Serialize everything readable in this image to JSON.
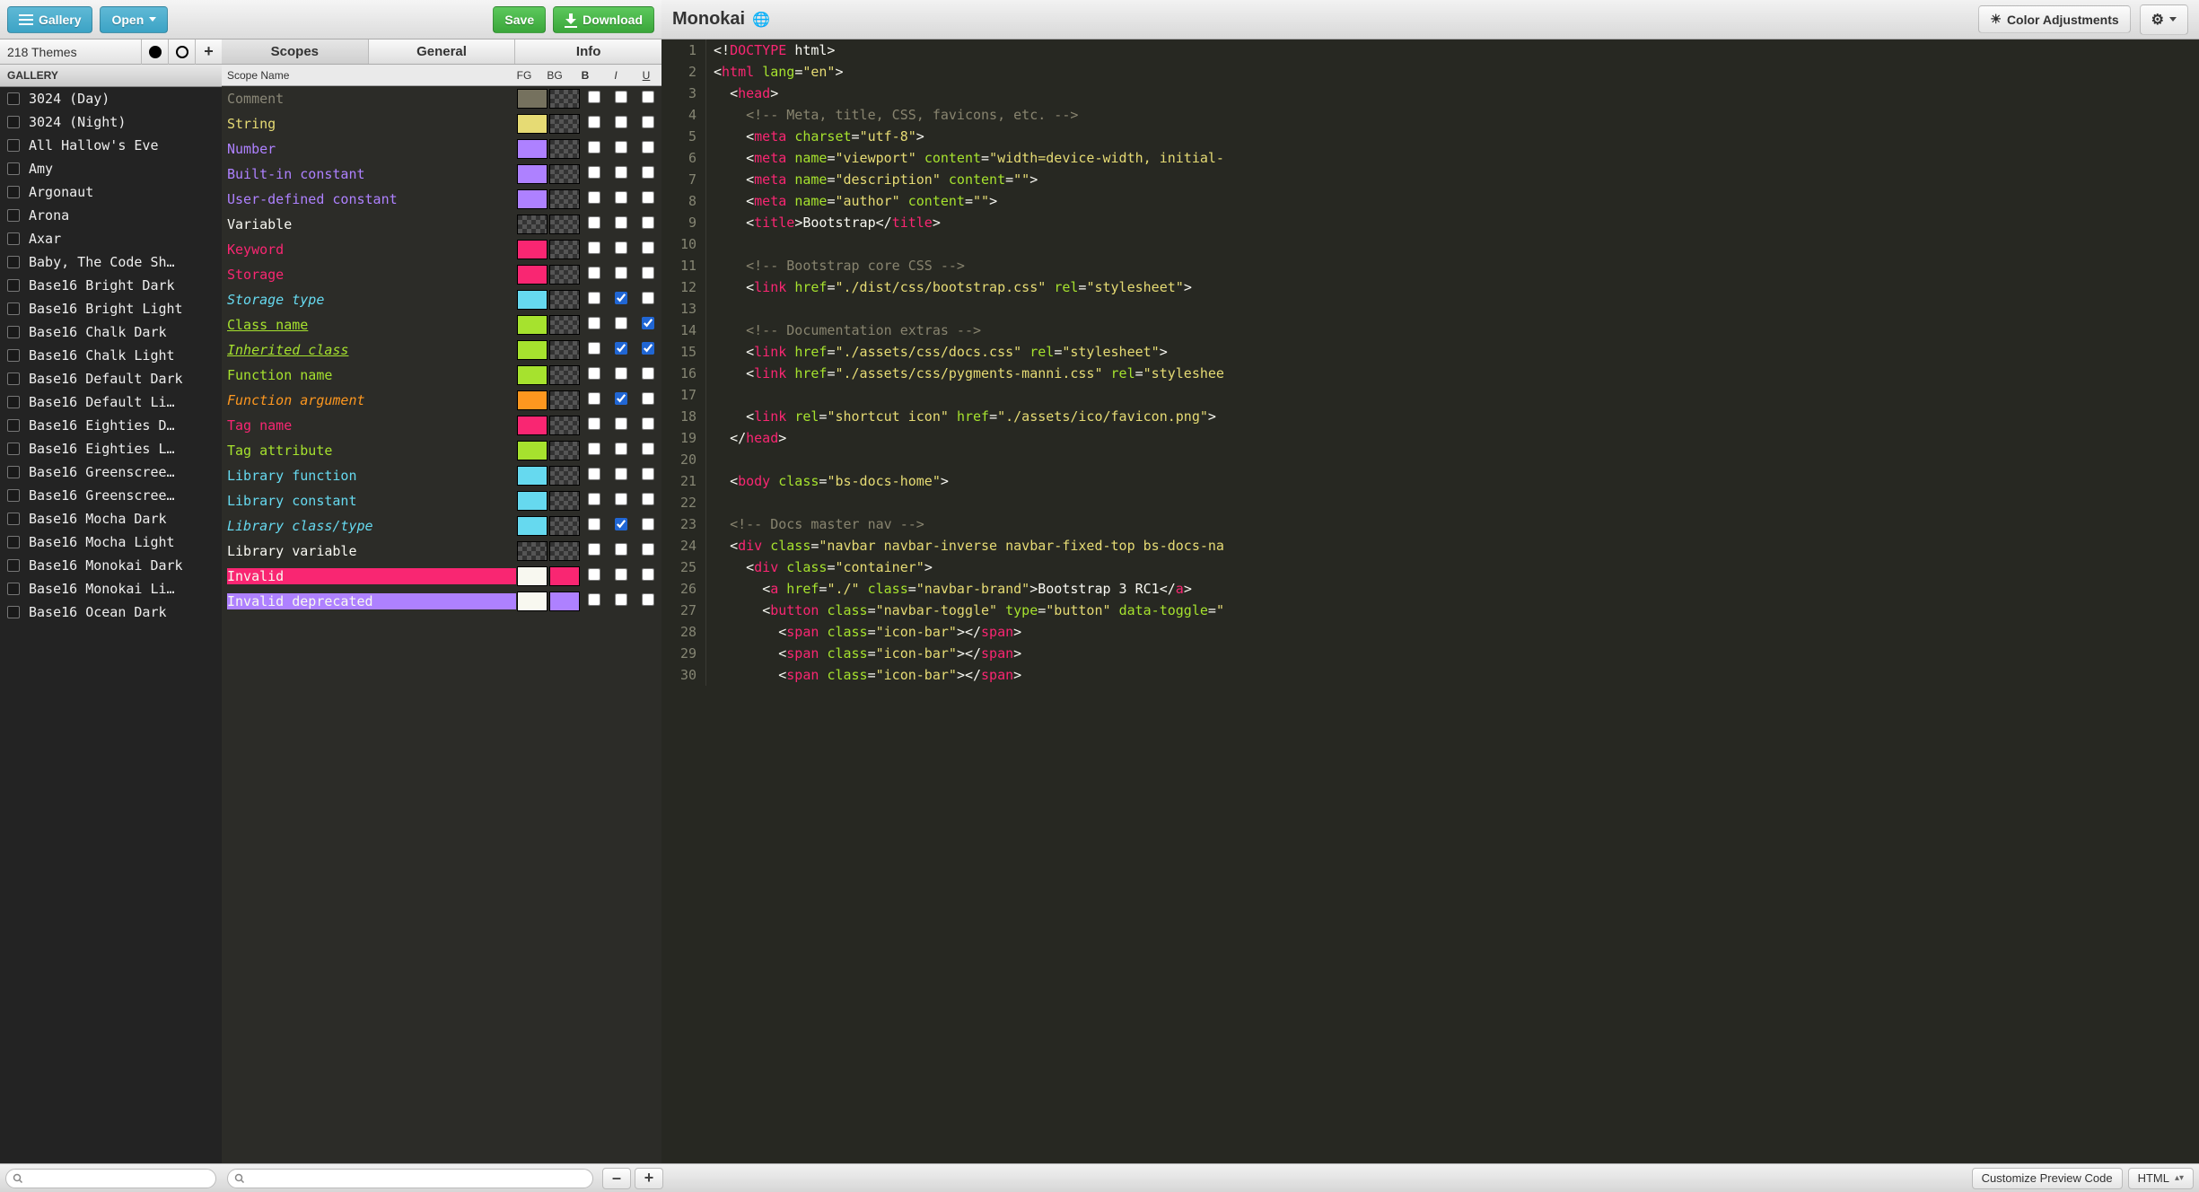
{
  "toolbar": {
    "gallery_label": "Gallery",
    "open_label": "Open",
    "save_label": "Save",
    "download_label": "Download",
    "color_adjust_label": "Color Adjustments"
  },
  "preview_title": "Monokai",
  "gallery": {
    "count_label": "218 Themes",
    "header_label": "GALLERY",
    "items": [
      "3024 (Day)",
      "3024 (Night)",
      "All Hallow's Eve",
      "Amy",
      "Argonaut",
      "Arona",
      "Axar",
      "Baby, The Code Sh…",
      "Base16 Bright Dark",
      "Base16 Bright Light",
      "Base16 Chalk Dark",
      "Base16 Chalk Light",
      "Base16 Default Dark",
      "Base16 Default Li…",
      "Base16 Eighties D…",
      "Base16 Eighties L…",
      "Base16 Greenscree…",
      "Base16 Greenscree…",
      "Base16 Mocha Dark",
      "Base16 Mocha Light",
      "Base16 Monokai Dark",
      "Base16 Monokai Li…",
      "Base16 Ocean Dark"
    ]
  },
  "tabs": {
    "scopes": "Scopes",
    "general": "General",
    "info": "Info",
    "active": "scopes"
  },
  "scope_header": {
    "name": "Scope Name",
    "fg": "FG",
    "bg": "BG",
    "b": "B",
    "i": "I",
    "u": "U"
  },
  "scopes": [
    {
      "name": "Comment",
      "fgColor": "#75715e",
      "bgColor": null,
      "b": false,
      "i": false,
      "u": false,
      "style": "color:#8a8777"
    },
    {
      "name": "String",
      "fgColor": "#e6db74",
      "bgColor": null,
      "b": false,
      "i": false,
      "u": false,
      "style": "color:#e6db74"
    },
    {
      "name": "Number",
      "fgColor": "#ae81ff",
      "bgColor": null,
      "b": false,
      "i": false,
      "u": false,
      "style": "color:#ae81ff"
    },
    {
      "name": "Built-in constant",
      "fgColor": "#ae81ff",
      "bgColor": null,
      "b": false,
      "i": false,
      "u": false,
      "style": "color:#ae81ff"
    },
    {
      "name": "User-defined constant",
      "fgColor": "#ae81ff",
      "bgColor": null,
      "b": false,
      "i": false,
      "u": false,
      "style": "color:#ae81ff"
    },
    {
      "name": "Variable",
      "fgColor": null,
      "bgColor": null,
      "b": false,
      "i": false,
      "u": false,
      "style": "color:#f8f8f2"
    },
    {
      "name": "Keyword",
      "fgColor": "#f92672",
      "bgColor": null,
      "b": false,
      "i": false,
      "u": false,
      "style": "color:#f92672"
    },
    {
      "name": "Storage",
      "fgColor": "#f92672",
      "bgColor": null,
      "b": false,
      "i": false,
      "u": false,
      "style": "color:#f92672"
    },
    {
      "name": "Storage type",
      "fgColor": "#66d9ef",
      "bgColor": null,
      "b": false,
      "i": true,
      "u": false,
      "style": "color:#66d9ef;font-style:italic"
    },
    {
      "name": "Class name",
      "fgColor": "#a6e22e",
      "bgColor": null,
      "b": false,
      "i": false,
      "u": true,
      "style": "color:#a6e22e;text-decoration:underline"
    },
    {
      "name": "Inherited class",
      "fgColor": "#a6e22e",
      "bgColor": null,
      "b": false,
      "i": true,
      "u": true,
      "style": "color:#a6e22e;font-style:italic;text-decoration:underline"
    },
    {
      "name": "Function name",
      "fgColor": "#a6e22e",
      "bgColor": null,
      "b": false,
      "i": false,
      "u": false,
      "style": "color:#a6e22e"
    },
    {
      "name": "Function argument",
      "fgColor": "#fd971f",
      "bgColor": null,
      "b": false,
      "i": true,
      "u": false,
      "style": "color:#fd971f;font-style:italic"
    },
    {
      "name": "Tag name",
      "fgColor": "#f92672",
      "bgColor": null,
      "b": false,
      "i": false,
      "u": false,
      "style": "color:#f92672"
    },
    {
      "name": "Tag attribute",
      "fgColor": "#a6e22e",
      "bgColor": null,
      "b": false,
      "i": false,
      "u": false,
      "style": "color:#a6e22e"
    },
    {
      "name": "Library function",
      "fgColor": "#66d9ef",
      "bgColor": null,
      "b": false,
      "i": false,
      "u": false,
      "style": "color:#66d9ef"
    },
    {
      "name": "Library constant",
      "fgColor": "#66d9ef",
      "bgColor": null,
      "b": false,
      "i": false,
      "u": false,
      "style": "color:#66d9ef"
    },
    {
      "name": "Library class/type",
      "fgColor": "#66d9ef",
      "bgColor": null,
      "b": false,
      "i": true,
      "u": false,
      "style": "color:#66d9ef;font-style:italic"
    },
    {
      "name": "Library variable",
      "fgColor": null,
      "bgColor": null,
      "b": false,
      "i": false,
      "u": false,
      "style": "color:#f8f8f2"
    },
    {
      "name": "Invalid",
      "fgColor": "#f8f8f0",
      "bgColor": "#f92672",
      "b": false,
      "i": false,
      "u": false,
      "style": "color:#f8f8f0;background:#f92672"
    },
    {
      "name": "Invalid deprecated",
      "fgColor": "#f8f8f0",
      "bgColor": "#ae81ff",
      "b": false,
      "i": false,
      "u": false,
      "style": "color:#f8f8f0;background:#ae81ff"
    }
  ],
  "editor_lines": [
    {
      "n": 1,
      "html": "<span class='t-punc'>&lt;!</span><span class='t-doc'>DOCTYPE</span> <span class='t-punc'>html&gt;</span>"
    },
    {
      "n": 2,
      "html": "<span class='t-punc'>&lt;</span><span class='t-tag'>html</span> <span class='t-attr'>lang</span><span class='t-punc'>=</span><span class='t-str'>\"en\"</span><span class='t-punc'>&gt;</span>"
    },
    {
      "n": 3,
      "html": "  <span class='t-punc'>&lt;</span><span class='t-tag'>head</span><span class='t-punc'>&gt;</span>"
    },
    {
      "n": 4,
      "html": "    <span class='t-com'>&lt;!-- Meta, title, CSS, favicons, etc. --&gt;</span>"
    },
    {
      "n": 5,
      "html": "    <span class='t-punc'>&lt;</span><span class='t-tag'>meta</span> <span class='t-attr'>charset</span><span class='t-punc'>=</span><span class='t-str'>\"utf-8\"</span><span class='t-punc'>&gt;</span>"
    },
    {
      "n": 6,
      "html": "    <span class='t-punc'>&lt;</span><span class='t-tag'>meta</span> <span class='t-attr'>name</span><span class='t-punc'>=</span><span class='t-str'>\"viewport\"</span> <span class='t-attr'>content</span><span class='t-punc'>=</span><span class='t-str'>\"width=device-width, initial-</span>"
    },
    {
      "n": 7,
      "html": "    <span class='t-punc'>&lt;</span><span class='t-tag'>meta</span> <span class='t-attr'>name</span><span class='t-punc'>=</span><span class='t-str'>\"description\"</span> <span class='t-attr'>content</span><span class='t-punc'>=</span><span class='t-str'>\"\"</span><span class='t-punc'>&gt;</span>"
    },
    {
      "n": 8,
      "html": "    <span class='t-punc'>&lt;</span><span class='t-tag'>meta</span> <span class='t-attr'>name</span><span class='t-punc'>=</span><span class='t-str'>\"author\"</span> <span class='t-attr'>content</span><span class='t-punc'>=</span><span class='t-str'>\"\"</span><span class='t-punc'>&gt;</span>"
    },
    {
      "n": 9,
      "html": "    <span class='t-punc'>&lt;</span><span class='t-tag'>title</span><span class='t-punc'>&gt;</span><span class='t-punc'>Bootstrap</span><span class='t-punc'>&lt;/</span><span class='t-tag'>title</span><span class='t-punc'>&gt;</span>"
    },
    {
      "n": 10,
      "html": ""
    },
    {
      "n": 11,
      "html": "    <span class='t-com'>&lt;!-- Bootstrap core CSS --&gt;</span>"
    },
    {
      "n": 12,
      "html": "    <span class='t-punc'>&lt;</span><span class='t-tag'>link</span> <span class='t-attr'>href</span><span class='t-punc'>=</span><span class='t-str'>\"./dist/css/bootstrap.css\"</span> <span class='t-attr'>rel</span><span class='t-punc'>=</span><span class='t-str'>\"stylesheet\"</span><span class='t-punc'>&gt;</span>"
    },
    {
      "n": 13,
      "html": ""
    },
    {
      "n": 14,
      "html": "    <span class='t-com'>&lt;!-- Documentation extras --&gt;</span>"
    },
    {
      "n": 15,
      "html": "    <span class='t-punc'>&lt;</span><span class='t-tag'>link</span> <span class='t-attr'>href</span><span class='t-punc'>=</span><span class='t-str'>\"./assets/css/docs.css\"</span> <span class='t-attr'>rel</span><span class='t-punc'>=</span><span class='t-str'>\"stylesheet\"</span><span class='t-punc'>&gt;</span>"
    },
    {
      "n": 16,
      "html": "    <span class='t-punc'>&lt;</span><span class='t-tag'>link</span> <span class='t-attr'>href</span><span class='t-punc'>=</span><span class='t-str'>\"./assets/css/pygments-manni.css\"</span> <span class='t-attr'>rel</span><span class='t-punc'>=</span><span class='t-str'>\"styleshee</span>"
    },
    {
      "n": 17,
      "html": ""
    },
    {
      "n": 18,
      "html": "    <span class='t-punc'>&lt;</span><span class='t-tag'>link</span> <span class='t-attr'>rel</span><span class='t-punc'>=</span><span class='t-str'>\"shortcut icon\"</span> <span class='t-attr'>href</span><span class='t-punc'>=</span><span class='t-str'>\"./assets/ico/favicon.png\"</span><span class='t-punc'>&gt;</span>"
    },
    {
      "n": 19,
      "html": "  <span class='t-punc'>&lt;/</span><span class='t-tag'>head</span><span class='t-punc'>&gt;</span>"
    },
    {
      "n": 20,
      "html": ""
    },
    {
      "n": 21,
      "html": "  <span class='t-punc'>&lt;</span><span class='t-tag'>body</span> <span class='t-attr'>class</span><span class='t-punc'>=</span><span class='t-str'>\"bs-docs-home\"</span><span class='t-punc'>&gt;</span>"
    },
    {
      "n": 22,
      "html": ""
    },
    {
      "n": 23,
      "html": "  <span class='t-com'>&lt;!-- Docs master nav --&gt;</span>"
    },
    {
      "n": 24,
      "html": "  <span class='t-punc'>&lt;</span><span class='t-tag'>div</span> <span class='t-attr'>class</span><span class='t-punc'>=</span><span class='t-str'>\"navbar navbar-inverse navbar-fixed-top bs-docs-na</span>"
    },
    {
      "n": 25,
      "html": "    <span class='t-punc'>&lt;</span><span class='t-tag'>div</span> <span class='t-attr'>class</span><span class='t-punc'>=</span><span class='t-str'>\"container\"</span><span class='t-punc'>&gt;</span>"
    },
    {
      "n": 26,
      "html": "      <span class='t-punc'>&lt;</span><span class='t-tag'>a</span> <span class='t-attr'>href</span><span class='t-punc'>=</span><span class='t-str'>\"./\"</span> <span class='t-attr'>class</span><span class='t-punc'>=</span><span class='t-str'>\"navbar-brand\"</span><span class='t-punc'>&gt;</span><span class='t-punc'>Bootstrap 3 RC1</span><span class='t-punc'>&lt;/</span><span class='t-tag'>a</span><span class='t-punc'>&gt;</span>"
    },
    {
      "n": 27,
      "html": "      <span class='t-punc'>&lt;</span><span class='t-tag'>button</span> <span class='t-attr'>class</span><span class='t-punc'>=</span><span class='t-str'>\"navbar-toggle\"</span> <span class='t-attr'>type</span><span class='t-punc'>=</span><span class='t-str'>\"button\"</span> <span class='t-attr'>data-toggle</span><span class='t-punc'>=</span><span class='t-str'>\"</span>"
    },
    {
      "n": 28,
      "html": "        <span class='t-punc'>&lt;</span><span class='t-tag'>span</span> <span class='t-attr'>class</span><span class='t-punc'>=</span><span class='t-str'>\"icon-bar\"</span><span class='t-punc'>&gt;&lt;/</span><span class='t-tag'>span</span><span class='t-punc'>&gt;</span>"
    },
    {
      "n": 29,
      "html": "        <span class='t-punc'>&lt;</span><span class='t-tag'>span</span> <span class='t-attr'>class</span><span class='t-punc'>=</span><span class='t-str'>\"icon-bar\"</span><span class='t-punc'>&gt;&lt;/</span><span class='t-tag'>span</span><span class='t-punc'>&gt;</span>"
    },
    {
      "n": 30,
      "html": "        <span class='t-punc'>&lt;</span><span class='t-tag'>span</span> <span class='t-attr'>class</span><span class='t-punc'>=</span><span class='t-str'>\"icon-bar\"</span><span class='t-punc'>&gt;&lt;/</span><span class='t-tag'>span</span><span class='t-punc'>&gt;</span>"
    }
  ],
  "footer": {
    "customize_label": "Customize Preview Code",
    "lang_label": "HTML"
  }
}
